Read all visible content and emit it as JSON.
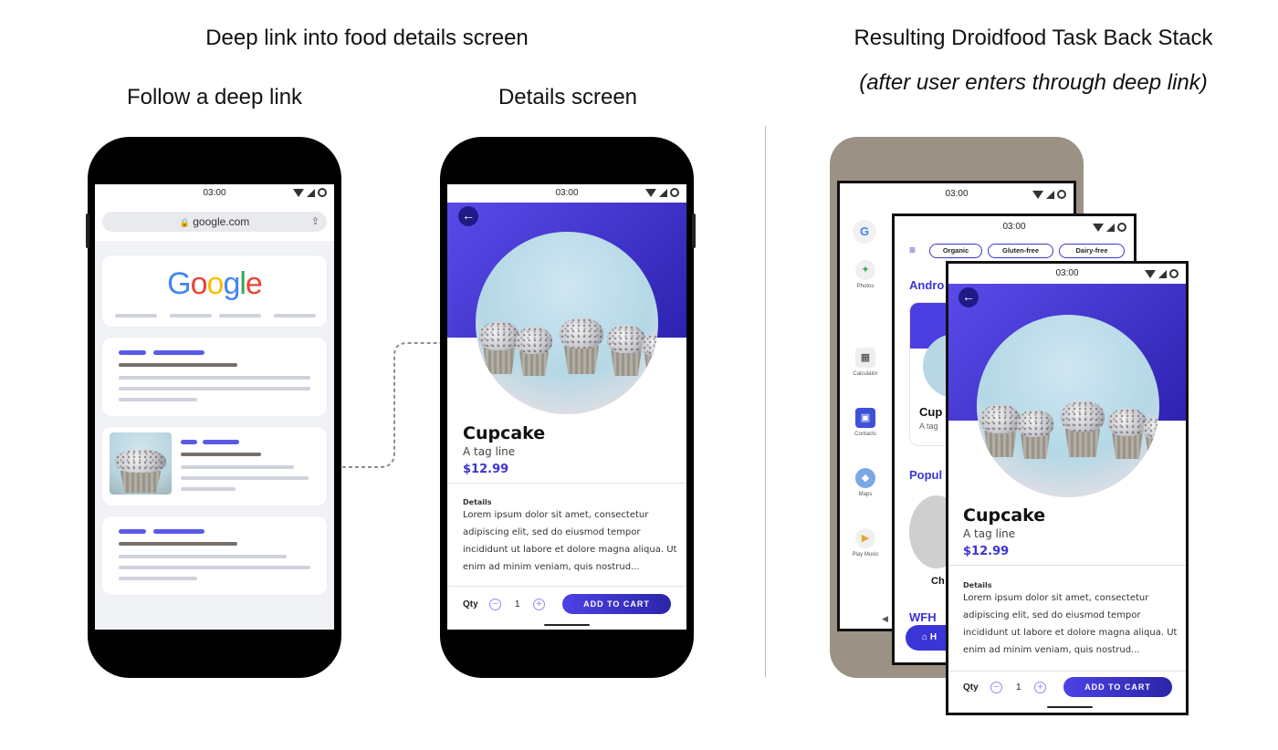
{
  "headings": {
    "left_title": "Deep link into food details screen",
    "follow_label": "Follow a deep link",
    "details_label": "Details screen",
    "right_title": "Resulting Droidfood Task Back Stack",
    "right_subtitle": "(after user enters through deep link)"
  },
  "status": {
    "time": "03:00"
  },
  "browser": {
    "url": "google.com",
    "logo": "Google",
    "logo_colors": [
      "#4285F4",
      "#EA4335",
      "#FBBC05",
      "#4285F4",
      "#34A853",
      "#EA4335"
    ]
  },
  "details": {
    "name": "Cupcake",
    "tagline": "A tag line",
    "price": "$12.99",
    "details_heading": "Details",
    "body": "Lorem ipsum dolor sit amet, consectetur adipiscing elit, sed do eiusmod tempor incididunt ut labore et dolore magna aliqua. Ut enim ad minim veniam, quis nostrud...",
    "qty_label": "Qty",
    "qty_value": "1",
    "minus": "−",
    "plus": "+",
    "add_to_cart": "ADD TO CART",
    "back_icon": "←"
  },
  "launcher": {
    "google_glyph": "G",
    "apps": [
      {
        "label": "Photos",
        "icon": "pinwheel-icon"
      },
      {
        "label": "Calculator",
        "icon": "calculator-icon"
      },
      {
        "label": "Contacts",
        "icon": "contacts-icon"
      },
      {
        "label": "Maps",
        "icon": "maps-icon"
      },
      {
        "label": "Play Music",
        "icon": "play-music-icon"
      }
    ]
  },
  "home": {
    "chips": [
      "Organic",
      "Gluten-free",
      "Dairy-free"
    ],
    "section_android": "Andro",
    "section_popular": "Popul",
    "section_wfh": "WFH",
    "card_name": "Cup",
    "card_tag": "A tag",
    "popular_item": "Ch",
    "home_tab": "H"
  },
  "colors": {
    "accent": "#3b34d6",
    "hero_start": "#5a4bea",
    "hero_end": "#2d22b0",
    "grey_phone": "#9b9184"
  }
}
